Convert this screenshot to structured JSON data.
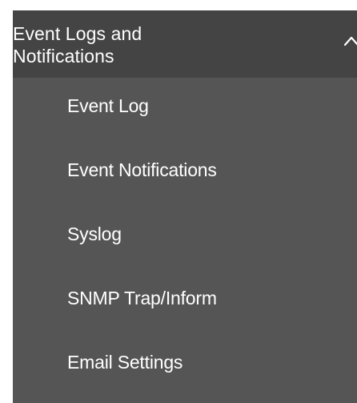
{
  "menu": {
    "section_title": "Event Logs and\nNotifications",
    "toggle_icon": "chevron-up-icon",
    "items": [
      {
        "label": "Event Log"
      },
      {
        "label": "Event Notifications"
      },
      {
        "label": "Syslog"
      },
      {
        "label": "SNMP Trap/Inform"
      },
      {
        "label": "Email Settings"
      }
    ],
    "colors": {
      "header_bg": "#444444",
      "list_bg": "#555555",
      "text": "#ffffff"
    }
  }
}
